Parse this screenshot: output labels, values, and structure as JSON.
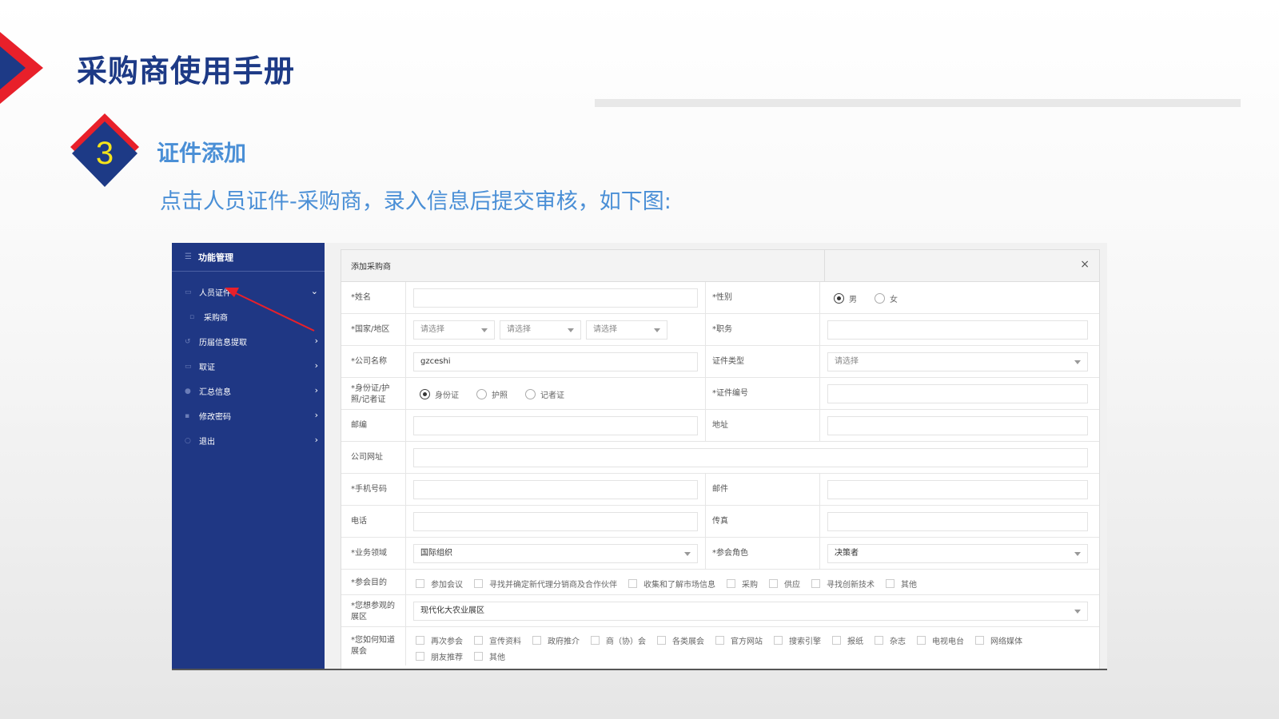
{
  "header": {
    "title": "采购商使用手册",
    "step_number": "3",
    "step_heading": "证件添加",
    "step_description": "点击人员证件-采购商，录入信息后提交审核，如下图:"
  },
  "sidebar": {
    "title": "功能管理",
    "items": [
      {
        "label": "人员证件",
        "expanded": true
      },
      {
        "label": "采购商",
        "sub": true
      },
      {
        "label": "历届信息提取"
      },
      {
        "label": "取证"
      },
      {
        "label": "汇总信息"
      },
      {
        "label": "修改密码"
      },
      {
        "label": "退出"
      }
    ]
  },
  "form": {
    "title": "添加采购商",
    "close": "×",
    "name_label": "*姓名",
    "gender_label": "*性别",
    "gender_options": [
      "男",
      "女"
    ],
    "gender_selected": "男",
    "country_label": "*国家/地区",
    "select_placeholder": "请选择",
    "position_label": "*职务",
    "company_label": "*公司名称",
    "company_value": "gzceshi",
    "cert_type_label": "证件类型",
    "id_type_label": "*身份证/护照/记者证",
    "id_type_options": [
      "身份证",
      "护照",
      "记者证"
    ],
    "id_type_selected": "身份证",
    "cert_no_label": "*证件编号",
    "postcode_label": "邮编",
    "address_label": "地址",
    "website_label": "公司网址",
    "mobile_label": "*手机号码",
    "email_label": "邮件",
    "phone_label": "电话",
    "fax_label": "传真",
    "business_label": "*业务领域",
    "business_value": "国际组织",
    "role_label": "*参会角色",
    "role_value": "决策者",
    "purpose_label": "*参会目的",
    "purpose_options": [
      "参加会议",
      "寻找并确定新代理分销商及合作伙伴",
      "收集和了解市场信息",
      "采购",
      "供应",
      "寻找创新技术",
      "其他"
    ],
    "hall_label": "*您想参观的展区",
    "hall_value": "现代化大农业展区",
    "source_label": "*您如何知道展会",
    "source_options": [
      "再次参会",
      "宣传资料",
      "政府推介",
      "商（协）会",
      "各类展会",
      "官方网站",
      "搜索引擎",
      "报纸",
      "杂志",
      "电视电台",
      "网络媒体",
      "朋友推荐",
      "其他"
    ]
  },
  "colors": {
    "title_blue": "#1d3a86",
    "accent_blue": "#4a8fd6",
    "sidebar": "#1f3784",
    "arrow_red": "#e8202a"
  }
}
